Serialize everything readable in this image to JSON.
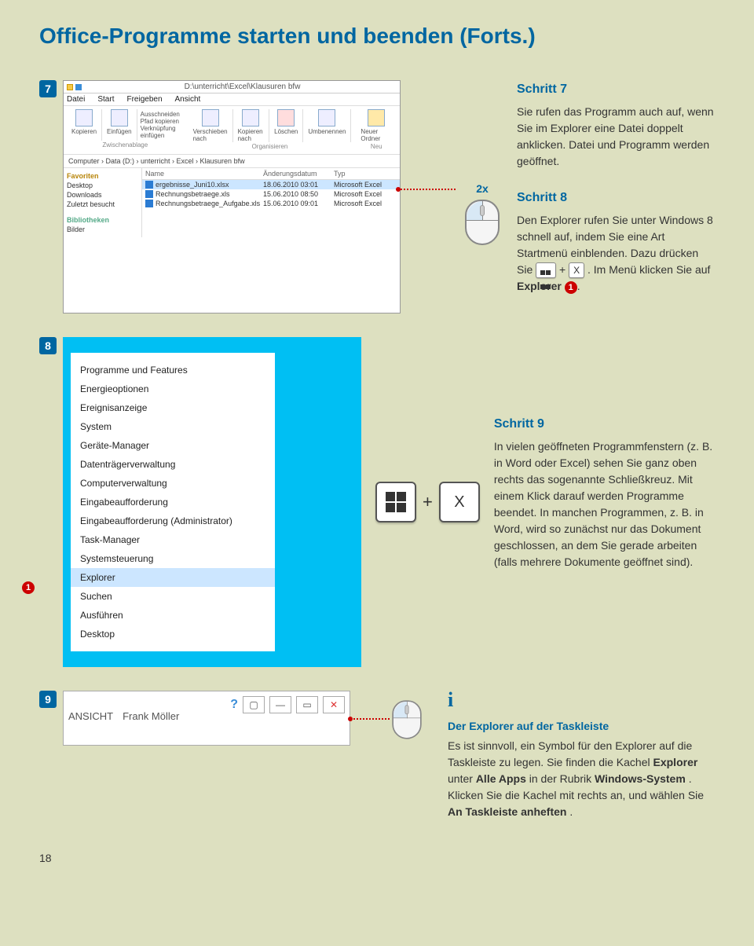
{
  "page_title": "Office-Programme starten und beenden (Forts.)",
  "page_number": "18",
  "badges": {
    "b7": "7",
    "b8": "8",
    "b9": "9",
    "r1": "1"
  },
  "explorer": {
    "window_title": "D:\\unterricht\\Excel\\Klausuren bfw",
    "tabs": [
      "Datei",
      "Start",
      "Freigeben",
      "Ansicht"
    ],
    "ribbon_labels": {
      "kopieren": "Kopieren",
      "einfugen": "Einfügen",
      "ausschneiden": "Ausschneiden",
      "pfad": "Pfad kopieren",
      "verkn": "Verknüpfung einfügen",
      "zwischen": "Zwischenablage",
      "verschieben": "Verschieben nach",
      "kopieren_nach": "Kopieren nach",
      "loeschen": "Löschen",
      "umbenennen": "Umbenennen",
      "organisieren": "Organisieren",
      "neuer_ordner": "Neuer Ordner",
      "neu": "Neu"
    },
    "breadcrumb": "Computer  ›  Data (D:)  ›  unterricht  ›  Excel  ›  Klausuren bfw",
    "sidebar": {
      "fav": "Favoriten",
      "items": [
        "Desktop",
        "Downloads",
        "Zuletzt besucht"
      ],
      "bib": "Bibliotheken",
      "bilder": "Bilder"
    },
    "columns": [
      "Name",
      "Änderungsdatum",
      "Typ"
    ],
    "rows": [
      {
        "name": "ergebnisse_Juni10.xlsx",
        "date": "18.06.2010 03:01",
        "type": "Microsoft Excel",
        "selected": true
      },
      {
        "name": "Rechnungsbetraege.xls",
        "date": "15.06.2010 08:50",
        "type": "Microsoft Excel",
        "selected": false
      },
      {
        "name": "Rechnungsbetraege_Aufgabe.xls",
        "date": "15.06.2010 09:01",
        "type": "Microsoft Excel",
        "selected": false
      }
    ]
  },
  "mouse_label": "2x",
  "step7": {
    "title": "Schritt 7",
    "body": "Sie rufen das Programm auch auf, wenn Sie im Explorer eine Datei doppelt anklicken. Datei und Programm werden geöffnet."
  },
  "step8": {
    "title": "Schritt 8",
    "body_a": "Den Explorer rufen Sie unter Windows 8 schnell auf, indem Sie eine Art Startmenü einblenden. Dazu drücken Sie ",
    "body_b": " + ",
    "key_x": "X",
    "body_c": ". Im Menü klicken Sie auf ",
    "bold": "Explorer",
    "body_d": " "
  },
  "menu": [
    "Programme und Features",
    "Energieoptionen",
    "Ereignisanzeige",
    "System",
    "Geräte-Manager",
    "Datenträgerverwaltung",
    "Computerverwaltung",
    "Eingabeaufforderung",
    "Eingabeaufforderung (Administrator)",
    "Task-Manager",
    "Systemsteuerung",
    "Explorer",
    "Suchen",
    "Ausführen",
    "Desktop"
  ],
  "key_combo": {
    "plus": "+",
    "x": "X"
  },
  "step9": {
    "title": "Schritt 9",
    "body": "In vielen geöffneten Programmfenstern (z. B. in Word oder Excel) sehen Sie ganz oben rechts das sogenannte Schließkreuz. Mit einem Klick darauf werden Programme beendet. In manchen Programmen, z. B. in Word, wird so zunächst nur das Dokument geschlossen, an dem Sie gerade arbeiten (falls mehrere Dokumente geöffnet sind).",
    "italic": "Schließkreuz"
  },
  "win_corner": {
    "ansicht": "ANSICHT",
    "user": "Frank Möller",
    "help": "?",
    "btn1": "▢",
    "btn2": "—",
    "btn3": "▭",
    "btn4": "✕"
  },
  "info": {
    "title": "Der Explorer auf der Taskleiste",
    "body_a": "Es ist sinnvoll, ein Symbol für den Explorer auf die Taskleiste zu legen. Sie finden die Kachel ",
    "b1": "Explorer",
    "body_b": " unter ",
    "b2": "Alle Apps",
    "body_c": " in der Rubrik ",
    "b3": "Windows-System",
    "body_d": ". Klicken Sie die Kachel mit rechts an, und wählen Sie ",
    "b4": "An Taskleiste anheften",
    "body_e": "."
  }
}
